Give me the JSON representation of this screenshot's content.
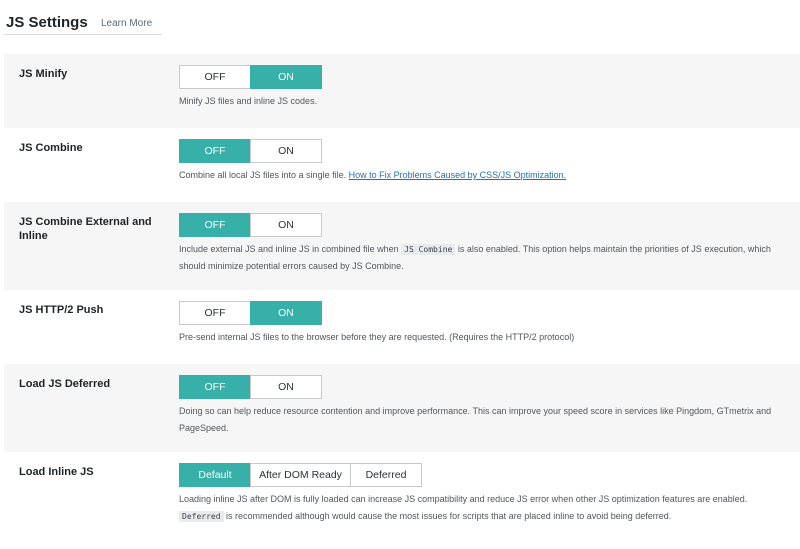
{
  "header": {
    "title": "JS Settings",
    "learn_more": "Learn More"
  },
  "colors": {
    "accent": "#36b0a9",
    "link": "#2271b1"
  },
  "settings": [
    {
      "label": "JS Minify",
      "options": [
        "OFF",
        "ON"
      ],
      "selected": "ON",
      "desc": "Minify JS files and inline JS codes."
    },
    {
      "label": "JS Combine",
      "options": [
        "OFF",
        "ON"
      ],
      "selected": "OFF",
      "desc_prefix": "Combine all local JS files into a single file.",
      "link": "How to Fix Problems Caused by CSS/JS Optimization."
    },
    {
      "label": "JS Combine External and Inline",
      "options": [
        "OFF",
        "ON"
      ],
      "selected": "OFF",
      "desc_prefix": "Include external JS and inline JS in combined file when",
      "code": "JS Combine",
      "desc_suffix": "is also enabled. This option helps maintain the priorities of JS execution, which should minimize potential errors caused by JS Combine."
    },
    {
      "label": "JS HTTP/2 Push",
      "options": [
        "OFF",
        "ON"
      ],
      "selected": "ON",
      "desc": "Pre-send internal JS files to the browser before they are requested. (Requires the HTTP/2 protocol)"
    },
    {
      "label": "Load JS Deferred",
      "options": [
        "OFF",
        "ON"
      ],
      "selected": "OFF",
      "desc": "Doing so can help reduce resource contention and improve performance. This can improve your speed score in services like Pingdom, GTmetrix and PageSpeed."
    },
    {
      "label": "Load Inline JS",
      "options": [
        "Default",
        "After DOM Ready",
        "Deferred"
      ],
      "selected": "Default",
      "desc_line1": "Loading inline JS after DOM is fully loaded can increase JS compatibility and reduce JS error when other JS optimization features are enabled.",
      "code": "Deferred",
      "desc_suffix": "is recommended although would cause the most issues for scripts that are placed inline to avoid being deferred."
    }
  ]
}
